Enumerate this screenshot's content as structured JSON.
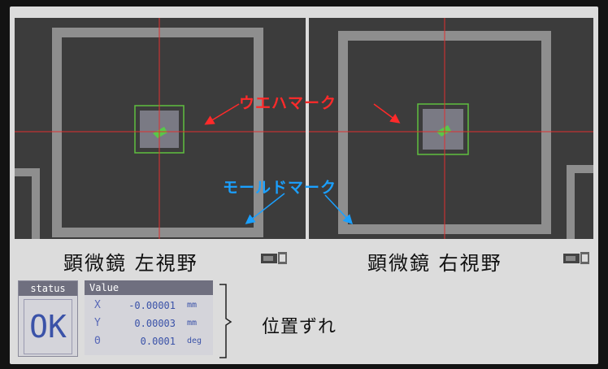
{
  "annotations": {
    "wafer_mark": "ウエハマーク",
    "mold_mark": "モールドマーク"
  },
  "views": {
    "left_label": "顕微鏡 左視野",
    "right_label": "顕微鏡 右視野"
  },
  "status": {
    "header": "status",
    "value": "OK"
  },
  "value_panel": {
    "header": "Value",
    "rows": [
      {
        "axis": "X",
        "value": "-0.00001",
        "unit": "mm"
      },
      {
        "axis": "Y",
        "value": "0.00003",
        "unit": "mm"
      },
      {
        "axis": "Θ",
        "value": "0.0001",
        "unit": "deg"
      }
    ]
  },
  "shift_label": "位置ずれ",
  "colors": {
    "annotation_red": "#ff2a2a",
    "annotation_blue": "#1aa0ff",
    "value_text": "#3a52a8",
    "panel_header": "#6f6f7f"
  }
}
